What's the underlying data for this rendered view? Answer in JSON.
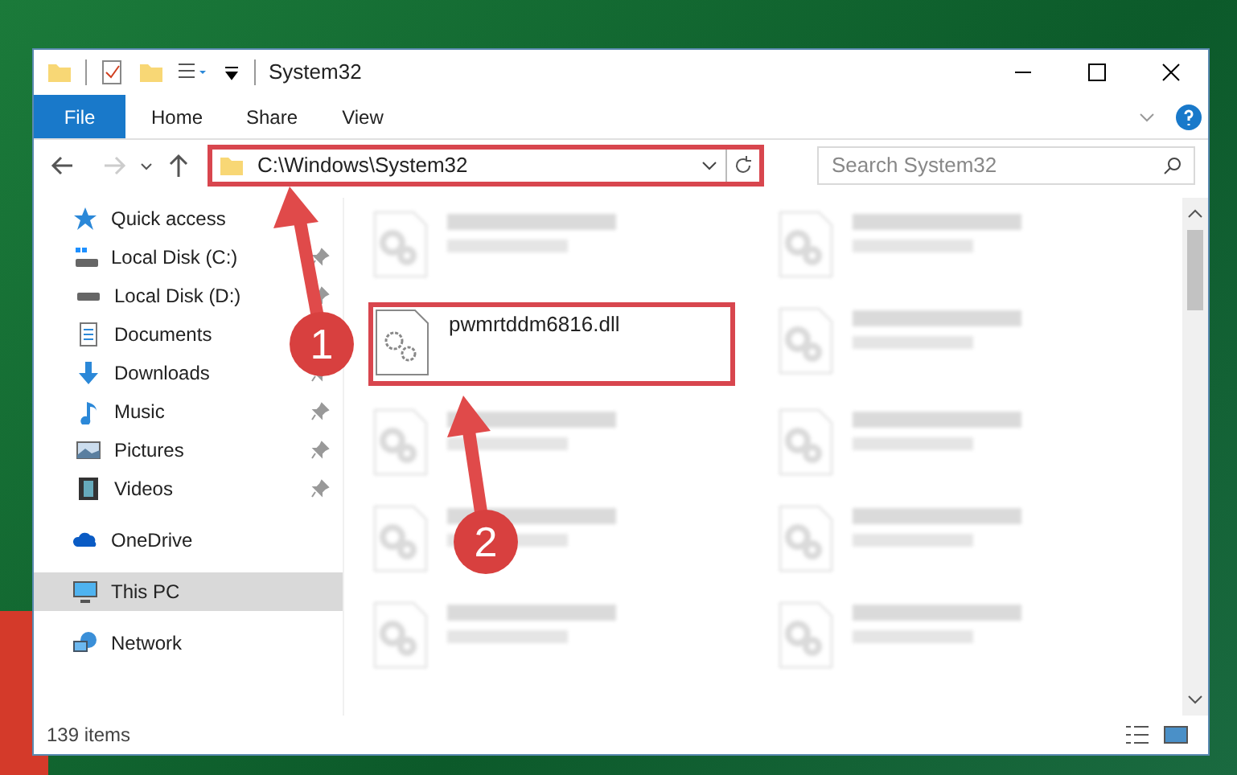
{
  "window": {
    "title": "System32"
  },
  "ribbon": {
    "tabs": [
      {
        "label": "File",
        "selected": true
      },
      {
        "label": "Home",
        "selected": false
      },
      {
        "label": "Share",
        "selected": false
      },
      {
        "label": "View",
        "selected": false
      }
    ]
  },
  "address_bar": {
    "path": "C:\\Windows\\System32",
    "highlighted": true
  },
  "search": {
    "placeholder": "Search System32"
  },
  "sidebar": {
    "items": [
      {
        "label": "Quick access",
        "kind": "star",
        "selected": false,
        "children": [
          {
            "label": "Local Disk (C:)",
            "kind": "disk-c",
            "pinned": true,
            "selected": false
          },
          {
            "label": "Local Disk (D:)",
            "kind": "disk",
            "pinned": true,
            "selected": false
          },
          {
            "label": "Documents",
            "kind": "documents",
            "selected": false
          },
          {
            "label": "Downloads",
            "kind": "downloads",
            "pinned": true,
            "selected": false
          },
          {
            "label": "Music",
            "kind": "music",
            "pinned": true,
            "selected": false
          },
          {
            "label": "Pictures",
            "kind": "pictures",
            "pinned": true,
            "selected": false
          },
          {
            "label": "Videos",
            "kind": "videos",
            "pinned": true,
            "selected": false
          }
        ]
      },
      {
        "label": "OneDrive",
        "kind": "cloud",
        "selected": false
      },
      {
        "label": "This PC",
        "kind": "pc",
        "selected": true
      },
      {
        "label": "Network",
        "kind": "network",
        "selected": false
      }
    ]
  },
  "files": [
    {
      "kind": "blurred"
    },
    {
      "kind": "blurred"
    },
    {
      "kind": "file",
      "name": "pwmrtddm6816.dll",
      "highlighted": true
    },
    {
      "kind": "blurred"
    },
    {
      "kind": "blurred"
    },
    {
      "kind": "blurred"
    },
    {
      "kind": "blurred"
    },
    {
      "kind": "blurred"
    },
    {
      "kind": "blurred"
    },
    {
      "kind": "blurred"
    }
  ],
  "status_bar": {
    "count": "139 items"
  },
  "annotations": [
    {
      "number": "1"
    },
    {
      "number": "2"
    }
  ]
}
